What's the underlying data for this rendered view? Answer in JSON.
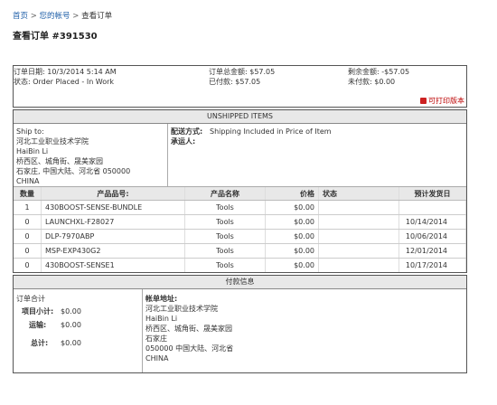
{
  "breadcrumb": {
    "home": "首页",
    "account": "您的帐号",
    "current": "查看订单",
    "sep": ">"
  },
  "page_title": "查看订单 #391530",
  "summary": {
    "order_date": "订单日期: 10/3/2014 5:14 AM",
    "status": "状态: Order Placed - In Work",
    "order_total": "订单总金额: $57.05",
    "paid": "已付款: $57.05",
    "remaining": "剩余金额: -$57.05",
    "unpaid": "未付款: $0.00",
    "print_link": "可打印版本"
  },
  "unshipped": {
    "header": "UNSHIPPED ITEMS",
    "ship_to_label": "Ship to:",
    "ship_to_lines": [
      "河北工业职业技术学院",
      "HaiBin Li",
      "桥西区、城角街、晟美家园",
      "石家庄, 中国大陆、河北省 050000",
      "CHINA"
    ],
    "delivery_label": "配送方式:",
    "delivery_value": "Shipping Included in Price of Item",
    "carrier_label": "承运人:",
    "columns": [
      "数量",
      "产品品号:",
      "产品名称",
      "价格",
      "状态",
      "预计发货日"
    ],
    "rows": [
      {
        "qty": "1",
        "part": "430BOOST-SENSE-BUNDLE",
        "name": "Tools",
        "price": "$0.00",
        "status": "",
        "ship": ""
      },
      {
        "qty": "0",
        "part": "LAUNCHXL-F28027",
        "name": "Tools",
        "price": "$0.00",
        "status": "",
        "ship": "10/14/2014"
      },
      {
        "qty": "0",
        "part": "DLP-7970ABP",
        "name": "Tools",
        "price": "$0.00",
        "status": "",
        "ship": "10/06/2014"
      },
      {
        "qty": "0",
        "part": "MSP-EXP430G2",
        "name": "Tools",
        "price": "$0.00",
        "status": "",
        "ship": "12/01/2014"
      },
      {
        "qty": "0",
        "part": "430BOOST-SENSE1",
        "name": "Tools",
        "price": "$0.00",
        "status": "",
        "ship": "10/17/2014"
      }
    ]
  },
  "payment": {
    "header": "付款信息",
    "order_total_label": "订单合计",
    "subtotal_label": "项目小计:",
    "subtotal_value": "$0.00",
    "shipping_label": "运输:",
    "shipping_value": "$0.00",
    "total_label": "总计:",
    "total_value": "$0.00",
    "billing_label": "帐单地址:",
    "billing_lines": [
      "河北工业职业技术学院",
      "HaiBin Li",
      "桥西区、城角街、晟美家园",
      "石家庄",
      "050000 中国大陆、河北省",
      "CHINA"
    ]
  },
  "colors": {
    "link": "#1f5fa8",
    "header_bg": "#e8e8e8",
    "print_icon": "#cc2222"
  }
}
